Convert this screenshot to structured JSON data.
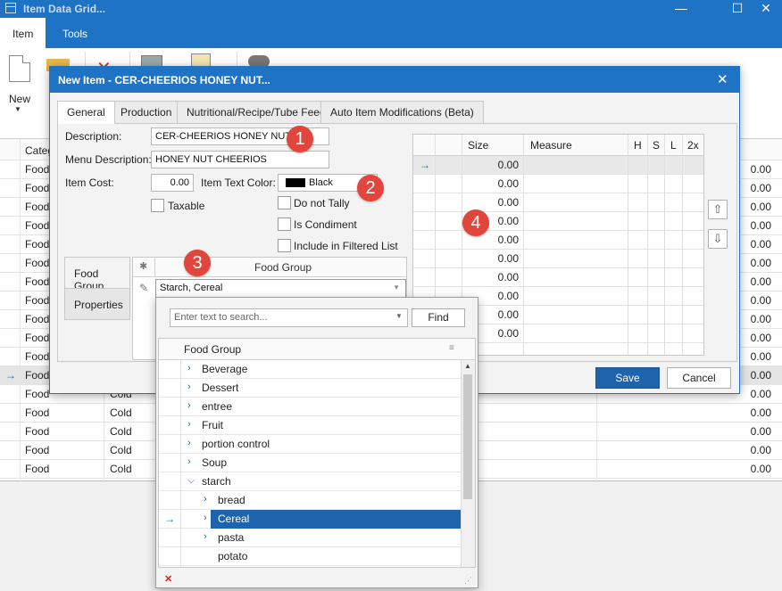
{
  "window": {
    "title": "Item Data Grid...",
    "minimize": "—",
    "maximize": "☐",
    "close": "✕"
  },
  "menu": {
    "tabs": [
      "Item",
      "Tools"
    ]
  },
  "ribbon": {
    "new_label": "New",
    "new_arrow": "▼"
  },
  "background_grid": {
    "column_header": "Categ",
    "row_pointer": "→",
    "rows": [
      {
        "category": "Food",
        "temp": "",
        "amount": "0.00"
      },
      {
        "category": "Food",
        "temp": "",
        "amount": "0.00"
      },
      {
        "category": "Food",
        "temp": "",
        "amount": "0.00"
      },
      {
        "category": "Food",
        "temp": "",
        "amount": "0.00"
      },
      {
        "category": "Food",
        "temp": "",
        "amount": "0.00"
      },
      {
        "category": "Food",
        "temp": "",
        "amount": "0.00"
      },
      {
        "category": "Food",
        "temp": "",
        "amount": "0.00"
      },
      {
        "category": "Food",
        "temp": "",
        "amount": "0.00"
      },
      {
        "category": "Food",
        "temp": "",
        "amount": "0.00"
      },
      {
        "category": "Food",
        "temp": "",
        "amount": "0.00"
      },
      {
        "category": "Food",
        "temp": "",
        "amount": "0.00"
      },
      {
        "category": "Food",
        "temp": "",
        "amount": "0.00"
      },
      {
        "category": "Food",
        "temp": "Cold",
        "amount": "0.00"
      },
      {
        "category": "Food",
        "temp": "Cold",
        "amount": "0.00"
      },
      {
        "category": "Food",
        "temp": "Cold",
        "amount": "0.00"
      },
      {
        "category": "Food",
        "temp": "Cold",
        "amount": "0.00"
      },
      {
        "category": "Food",
        "temp": "Cold",
        "amount": "0.00"
      }
    ]
  },
  "dialog": {
    "title": "New Item - CER-CHEERIOS HONEY NUT...",
    "close": "✕",
    "tabs": [
      "General",
      "Production",
      "Nutritional/Recipe/Tube Feed",
      "Auto Item Modifications (Beta)"
    ],
    "description_label": "Description:",
    "description_value": "CER-CHEERIOS HONEY NUT",
    "menu_description_label": "Menu Description:",
    "menu_description_value": "HONEY NUT CHEERIOS",
    "item_cost_label": "Item Cost:",
    "item_cost_value": "0.00",
    "text_color_label": "Item Text Color:",
    "text_color_value": "Black",
    "taxable_label": "Taxable",
    "do_not_tally_label": "Do not Tally",
    "is_condiment_label": "Is Condiment",
    "include_filtered_label": "Include in Filtered List",
    "left_tabs": [
      "Food Group",
      "Properties"
    ],
    "food_group_header": "Food Group",
    "food_group_value": "Starch, Cereal",
    "new_row_icon": "✱",
    "edit_icon": "✎",
    "size_grid": {
      "columns": [
        "Size",
        "Measure",
        "H",
        "S",
        "L",
        "2x"
      ],
      "row_pointer": "→",
      "rows": [
        "0.00",
        "0.00",
        "0.00",
        "0.00",
        "0.00",
        "0.00",
        "0.00",
        "0.00",
        "0.00",
        "0.00"
      ]
    },
    "move_up": "⇧",
    "move_down": "⇩",
    "save_label": "Save",
    "cancel_label": "Cancel"
  },
  "badges": [
    "1",
    "2",
    "3",
    "4"
  ],
  "dropdown": {
    "search_placeholder": "Enter text to search...",
    "find_label": "Find",
    "column_header": "Food Group",
    "expanded_icon": "⌵",
    "collapsed_icon": "›",
    "items": [
      {
        "label": "Beverage",
        "level": 0,
        "expanded": false
      },
      {
        "label": "Dessert",
        "level": 0,
        "expanded": false
      },
      {
        "label": "entree",
        "level": 0,
        "expanded": false
      },
      {
        "label": "Fruit",
        "level": 0,
        "expanded": false
      },
      {
        "label": "portion control",
        "level": 0,
        "expanded": false
      },
      {
        "label": "Soup",
        "level": 0,
        "expanded": false
      },
      {
        "label": "starch",
        "level": 0,
        "expanded": true
      },
      {
        "label": "bread",
        "level": 1,
        "expanded": false
      },
      {
        "label": "Cereal",
        "level": 1,
        "expanded": false,
        "selected": true
      },
      {
        "label": "pasta",
        "level": 1,
        "expanded": false
      },
      {
        "label": "potato",
        "level": 1,
        "expanded": null
      }
    ],
    "clear_icon": "✕"
  },
  "colors": {
    "accent": "#1f73c5",
    "selection": "#1f63ad",
    "badge": "#e2453c",
    "clear": "#e02020"
  }
}
